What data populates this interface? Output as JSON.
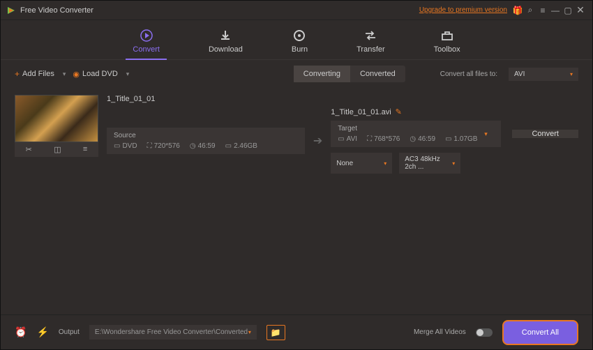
{
  "app": {
    "title": "Free Video Converter",
    "upgrade": "Upgrade to premium version"
  },
  "tabs": [
    {
      "label": "Convert"
    },
    {
      "label": "Download"
    },
    {
      "label": "Burn"
    },
    {
      "label": "Transfer"
    },
    {
      "label": "Toolbox"
    }
  ],
  "toolbar": {
    "add_files": "Add Files",
    "load_dvd": "Load DVD",
    "seg_converting": "Converting",
    "seg_converted": "Converted",
    "convert_all_label": "Convert all files to:",
    "format": "AVI"
  },
  "item": {
    "source_title": "1_Title_01_01",
    "source_label": "Source",
    "source_type": "DVD",
    "source_res": "720*576",
    "source_dur": "46:59",
    "source_size": "2.46GB",
    "target_title": "1_Title_01_01.avi",
    "target_label": "Target",
    "target_type": "AVI",
    "target_res": "768*576",
    "target_dur": "46:59",
    "target_size": "1.07GB",
    "convert_btn": "Convert",
    "subtitle": "None",
    "audio": "AC3 48kHz 2ch ..."
  },
  "footer": {
    "output_label": "Output",
    "output_path": "E:\\Wondershare Free Video Converter\\Converted",
    "merge_label": "Merge All Videos",
    "convert_all": "Convert All"
  }
}
